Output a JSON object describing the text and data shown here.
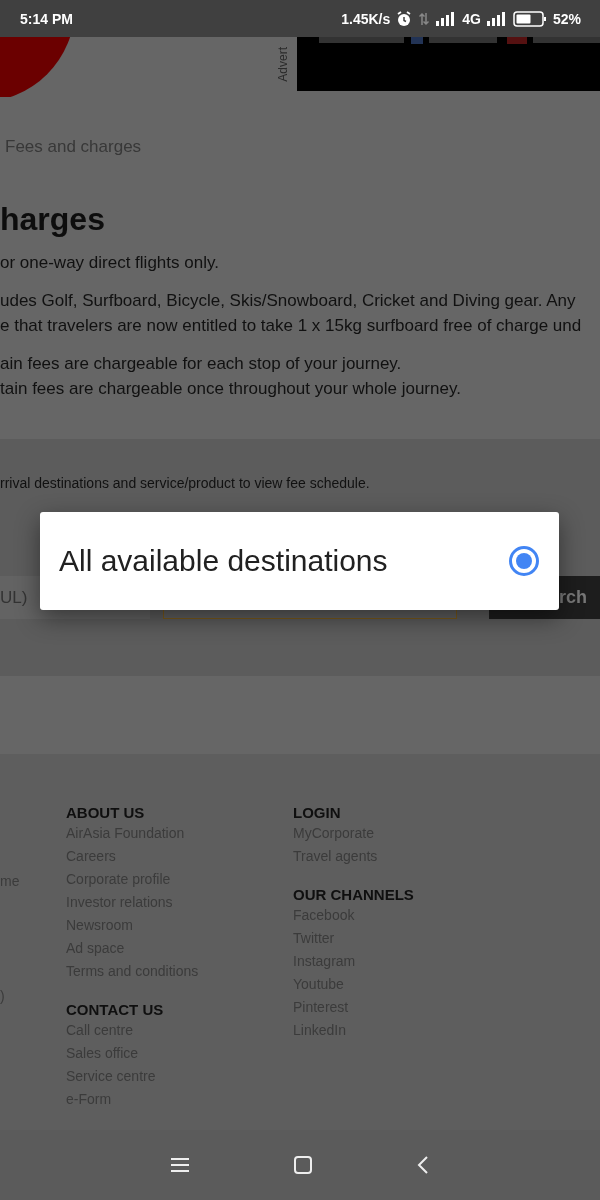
{
  "status_bar": {
    "time": "5:14 PM",
    "speed": "1.45K/s",
    "network": "4G",
    "battery": "52%"
  },
  "advert": {
    "label": "Advert",
    "kind": "picture"
  },
  "breadcrumb": "Fees and charges",
  "heading": "harges",
  "paragraphs": [
    [
      "or one-way direct flights only."
    ],
    [
      "udes Golf, Surfboard, Bicycle, Skis/Snowboard, Cricket and Diving gear. Any",
      "e that travelers are now entitled to take 1 x 15kg surfboard free of charge und"
    ],
    [
      "ain fees are chargeable for each stop of your journey.",
      "tain fees are chargeable once throughout your whole journey."
    ]
  ],
  "fee_search": {
    "instruction": "rrival destinations and service/product to view fee schedule.",
    "origin_value": "UL)",
    "button": "rch"
  },
  "dialog": {
    "options": [
      {
        "label": "All available destinations",
        "selected": true
      }
    ]
  },
  "footer": {
    "left_fragments": [
      "me",
      ")"
    ],
    "columns": [
      [
        {
          "title": "ABOUT US",
          "links": [
            "AirAsia Foundation",
            "Careers",
            "Corporate profile",
            "Investor relations",
            "Newsroom",
            "Ad space",
            "Terms and conditions"
          ]
        },
        {
          "title": "CONTACT US",
          "links": [
            "Call centre",
            "Sales office",
            "Service centre",
            "e-Form"
          ]
        }
      ],
      [
        {
          "title": "LOGIN",
          "links": [
            "MyCorporate",
            "Travel agents"
          ]
        },
        {
          "title": "OUR CHANNELS",
          "links": [
            "Facebook",
            "Twitter",
            "Instagram",
            "Youtube",
            "Pinterest",
            "LinkedIn"
          ]
        }
      ]
    ]
  }
}
